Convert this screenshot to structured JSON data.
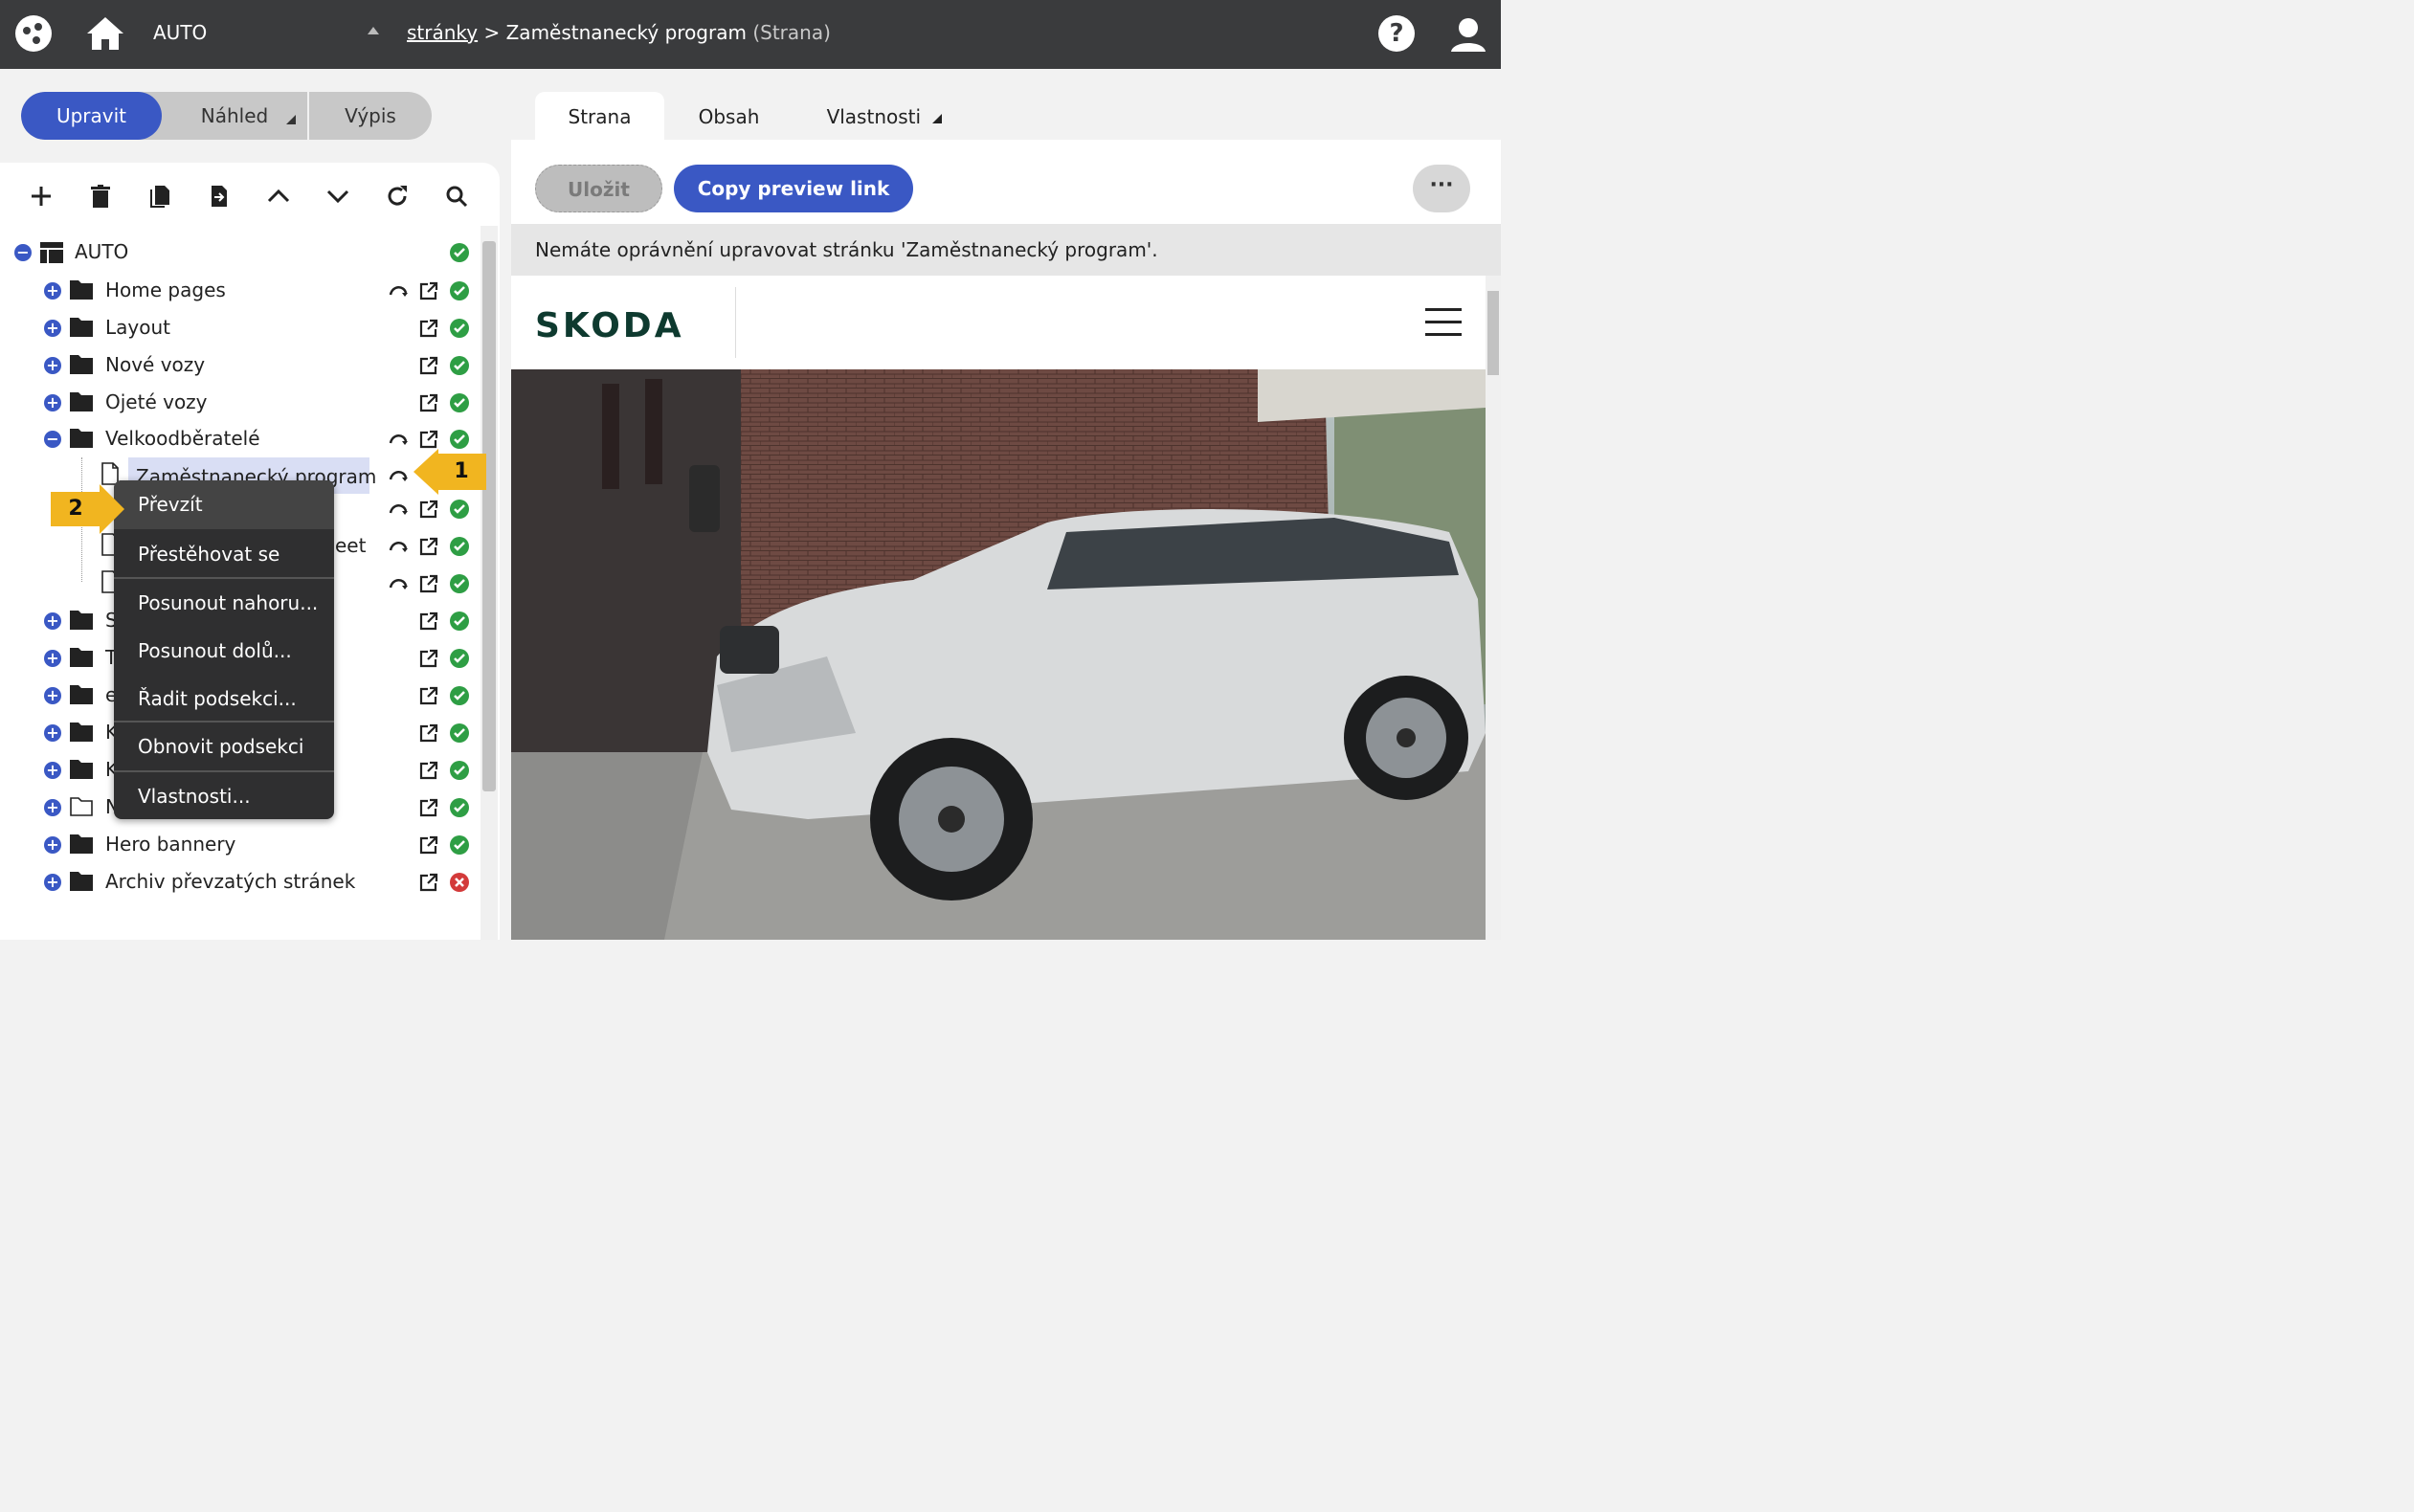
{
  "topbar": {
    "site_name": "AUTO",
    "breadcrumb_link": "stránky",
    "breadcrumb_sep": ">",
    "breadcrumb_current": "Zaměstnanecký program",
    "breadcrumb_type": "(Strana)",
    "help_label": "?"
  },
  "modes": {
    "edit": "Upravit",
    "preview": "Náhled",
    "list": "Výpis"
  },
  "tree": {
    "root": "AUTO",
    "items": [
      {
        "label": "Home pages"
      },
      {
        "label": "Layout"
      },
      {
        "label": "Nové vozy"
      },
      {
        "label": "Ojeté vozy"
      },
      {
        "label": "Velkoodběratelé"
      },
      {
        "label": "Zaměstnanecký program"
      },
      {
        "label": "eet"
      },
      {
        "label": "S"
      },
      {
        "label": "T"
      },
      {
        "label": "e"
      },
      {
        "label": "K"
      },
      {
        "label": "K"
      },
      {
        "label": "N"
      },
      {
        "label": "Hero bannery"
      },
      {
        "label": "Archiv převzatých stránek"
      }
    ]
  },
  "context_menu": {
    "items": [
      "Převzít",
      "Přestěhovat se",
      "Posunout nahoru...",
      "Posunout dolů...",
      "Řadit podsekci...",
      "Obnovit podsekci",
      "Vlastnosti..."
    ]
  },
  "callouts": {
    "one": "1",
    "two": "2"
  },
  "tabs": {
    "page": "Strana",
    "content": "Obsah",
    "properties": "Vlastnosti"
  },
  "actions": {
    "save": "Uložit",
    "copy_link": "Copy preview link",
    "more": "···"
  },
  "notice": "Nemáte oprávnění upravovat stránku 'Zaměstnanecký program'.",
  "preview": {
    "brand": "SKODA"
  },
  "colors": {
    "primary": "#3a58c4",
    "topbar": "#3a3b3d",
    "ok": "#2e9e44",
    "error": "#d33a3a",
    "callout": "#f1b520"
  }
}
